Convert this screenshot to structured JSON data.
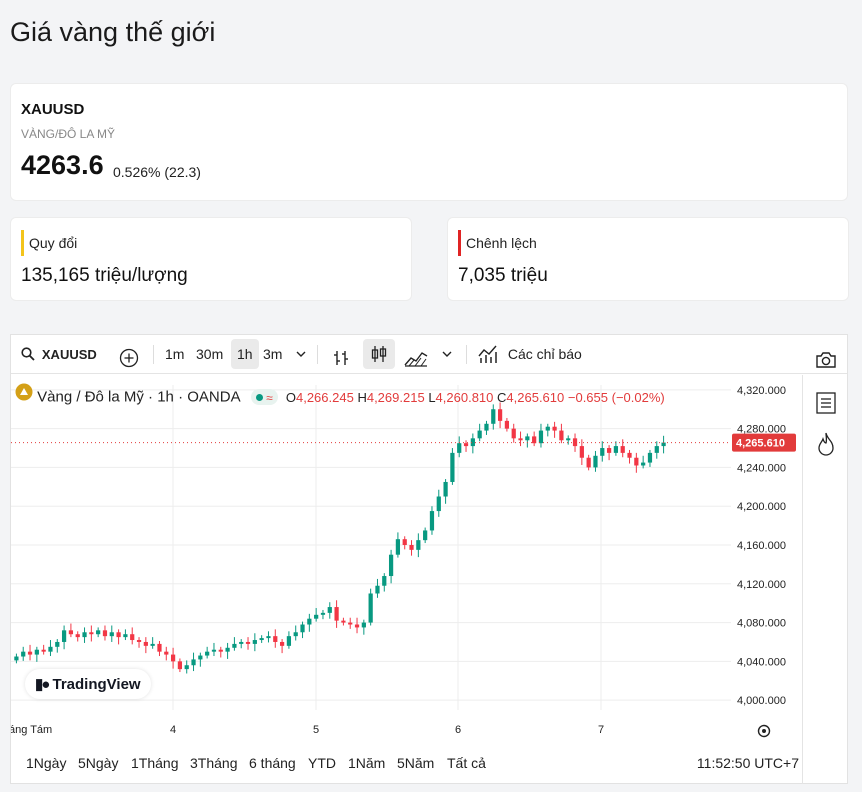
{
  "page": {
    "title": "Giá vàng thế giới"
  },
  "quote": {
    "symbol": "XAUUSD",
    "subtitle": "VÀNG/ĐÔ LA MỸ",
    "price": "4263.6",
    "change": "0.526% (22.3)"
  },
  "stats": {
    "convert": {
      "label": "Quy đổi",
      "value": "135,165 triệu/lượng"
    },
    "spread": {
      "label": "Chênh lệch",
      "value": "7,035 triệu"
    }
  },
  "toolbar": {
    "symbol": "XAUUSD",
    "intervals": [
      "1m",
      "30m",
      "1h",
      "3m"
    ],
    "active_interval": "1h",
    "indicators_label": "Các chỉ báo"
  },
  "legend": {
    "title": "Vàng / Đô la Mỹ · 1h · OANDA",
    "o_key": "O",
    "o_val": "4,266.245",
    "h_key": "H",
    "h_val": "4,269.215",
    "l_key": "L",
    "l_val": "4,260.810",
    "c_key": "C",
    "c_val": "4,265.610",
    "chg": "−0.655 (−0.02%)"
  },
  "chart": {
    "last_price_label": "4,265.610",
    "watermark": "TradingView",
    "colors": {
      "up": "#089981",
      "down": "#f23645",
      "last": "#e23b3b"
    }
  },
  "chart_data": {
    "type": "candlestick",
    "title": "Vàng / Đô la Mỹ · 1h · OANDA",
    "y_ticks": [
      "4,320.000",
      "4,280.000",
      "4,240.000",
      "4,200.000",
      "4,160.000",
      "4,120.000",
      "4,080.000",
      "4,040.000",
      "4,000.000"
    ],
    "y_tick_values": [
      4320,
      4280,
      4240,
      4200,
      4160,
      4120,
      4080,
      4040,
      4000
    ],
    "ylim": [
      3995,
      4325
    ],
    "x_ticks": [
      "áng Tám",
      "4",
      "5",
      "6",
      "7"
    ],
    "closes": [
      4045,
      4050,
      4047,
      4052,
      4050,
      4055,
      4060,
      4072,
      4068,
      4065,
      4070,
      4068,
      4072,
      4066,
      4070,
      4065,
      4068,
      4062,
      4060,
      4056,
      4058,
      4050,
      4047,
      4040,
      4032,
      4036,
      4042,
      4046,
      4050,
      4052,
      4050,
      4054,
      4058,
      4060,
      4058,
      4062,
      4064,
      4066,
      4060,
      4056,
      4066,
      4070,
      4078,
      4084,
      4088,
      4090,
      4096,
      4082,
      4080,
      4078,
      4075,
      4080,
      4110,
      4118,
      4128,
      4150,
      4166,
      4160,
      4155,
      4165,
      4175,
      4195,
      4210,
      4225,
      4255,
      4265,
      4262,
      4270,
      4278,
      4285,
      4300,
      4288,
      4280,
      4270,
      4268,
      4272,
      4265,
      4278,
      4282,
      4278,
      4268,
      4270,
      4262,
      4250,
      4240,
      4252,
      4260,
      4255,
      4262,
      4255,
      4250,
      4242,
      4245,
      4255,
      4262,
      4265.61
    ],
    "last_value": 4265.61
  },
  "ranges": [
    "1Ngày",
    "5Ngày",
    "1Tháng",
    "3Tháng",
    "6 tháng",
    "YTD",
    "1Năm",
    "5Năm",
    "Tất cả"
  ],
  "time_label": "11:52:50 UTC+7"
}
